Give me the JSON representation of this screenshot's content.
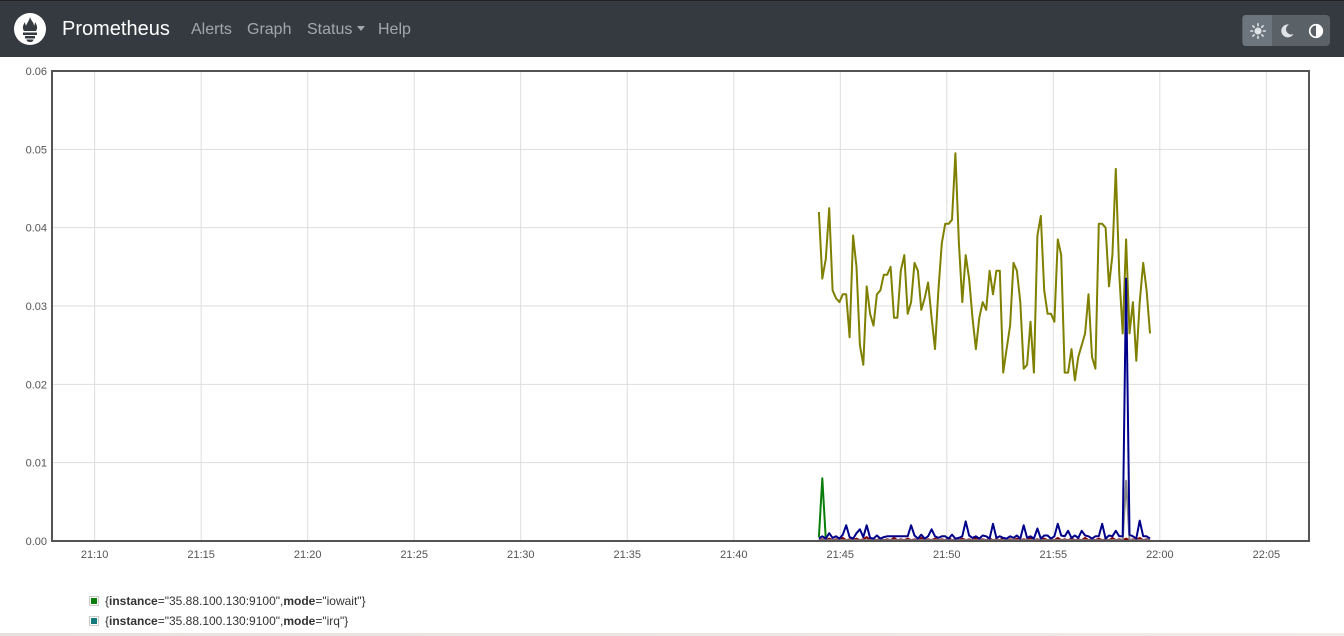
{
  "navbar": {
    "brand": "Prometheus",
    "links": [
      "Alerts",
      "Graph",
      "Status",
      "Help"
    ],
    "theme_buttons": [
      "sun-icon",
      "moon-icon",
      "half-circle-icon"
    ],
    "background": "#343a40"
  },
  "legend": [
    {
      "open": "{",
      "k1": "instance",
      "v1": "=\"35.88.100.130:9100\", ",
      "k2": "mode",
      "v2": "=\"iowait\"}",
      "color": "#0a7d0a"
    },
    {
      "open": "{",
      "k1": "instance",
      "v1": "=\"35.88.100.130:9100\", ",
      "k2": "mode",
      "v2": "=\"irq\"}",
      "color": "#137b7b"
    }
  ],
  "chart_data": {
    "type": "line",
    "x_ticks": [
      "21:10",
      "21:15",
      "21:20",
      "21:25",
      "21:30",
      "21:35",
      "21:40",
      "21:45",
      "21:50",
      "21:55",
      "22:00",
      "22:05"
    ],
    "y_ticks": [
      "0.00",
      "0.01",
      "0.02",
      "0.03",
      "0.04",
      "0.05",
      "0.06"
    ],
    "xlim_minutes": [
      21.1333,
      22.1167
    ],
    "ylim": [
      0,
      0.06
    ],
    "grid": true,
    "series": [
      {
        "color": "#808000",
        "x_start": 21.7333,
        "x_step": 0.00267,
        "values": [
          0.042,
          0.0335,
          0.036,
          0.0425,
          0.032,
          0.031,
          0.0305,
          0.0315,
          0.0315,
          0.026,
          0.039,
          0.035,
          0.025,
          0.0225,
          0.0325,
          0.029,
          0.0275,
          0.0315,
          0.032,
          0.034,
          0.034,
          0.035,
          0.0285,
          0.0285,
          0.0345,
          0.0365,
          0.029,
          0.0305,
          0.0355,
          0.0345,
          0.0295,
          0.031,
          0.033,
          0.0285,
          0.0245,
          0.032,
          0.038,
          0.0405,
          0.0405,
          0.041,
          0.0495,
          0.038,
          0.0305,
          0.0365,
          0.0335,
          0.0285,
          0.0245,
          0.0285,
          0.0305,
          0.0295,
          0.0345,
          0.0315,
          0.0345,
          0.0345,
          0.0215,
          0.0245,
          0.0275,
          0.0355,
          0.0345,
          0.0305,
          0.022,
          0.0225,
          0.028,
          0.0215,
          0.039,
          0.0415,
          0.032,
          0.029,
          0.029,
          0.028,
          0.0385,
          0.0365,
          0.0215,
          0.0215,
          0.0245,
          0.0205,
          0.0235,
          0.025,
          0.0265,
          0.0315,
          0.0235,
          0.022,
          0.0405,
          0.0405,
          0.04,
          0.0325,
          0.0365,
          0.0475,
          0.034,
          0.0265,
          0.0385,
          0.0265,
          0.0305,
          0.023,
          0.0305,
          0.0355,
          0.032,
          0.0265
        ]
      },
      {
        "color": "#0a7d0a",
        "x_start": 21.7333,
        "x_step": 0.00267,
        "values": [
          0.0005,
          0.008,
          0.0002,
          0.0001,
          0.0001,
          0.0001,
          0.0002,
          0.0001,
          0.0001,
          0.0001,
          0.0001,
          0.0001,
          0.0001,
          0.0001,
          0.0001,
          0.0001,
          0.0001,
          0.0001,
          0.0001,
          0.0001,
          0.0001,
          0.0001,
          0.0001,
          0.0001,
          0.0001,
          0.0001,
          0.0001,
          0.0001,
          0.0001,
          0.0001,
          0.0001,
          0.0001,
          0.0001,
          0.0001,
          0.0001,
          0.0001,
          0.0001,
          0.0001,
          0.0001,
          0.0001,
          0.0001,
          0.0001,
          0.0001,
          0.0001,
          0.0001,
          0.0001,
          0.0001,
          0.0001,
          0.0001,
          0.0001,
          0.0001,
          0.0001,
          0.0001,
          0.0001,
          0.0001,
          0.0001,
          0.0001,
          0.0001,
          0.0001,
          0.0001,
          0.0001,
          0.0001,
          0.0001,
          0.0001,
          0.0001,
          0.0001,
          0.0001,
          0.0001,
          0.0001,
          0.0001,
          0.0001,
          0.0001,
          0.0001,
          0.0001,
          0.0001,
          0.0001,
          0.0001,
          0.0001,
          0.0001,
          0.0001,
          0.0001,
          0.0001,
          0.0001,
          0.0001,
          0.0001,
          0.0001,
          0.0001,
          0.0001,
          0.0001,
          0.0001,
          0.0001,
          0.0001,
          0.0001,
          0.0001,
          0.0001,
          0.0001,
          0.0001,
          0.0001
        ]
      },
      {
        "color": "#800000",
        "x_start": 21.7333,
        "x_step": 0.00267,
        "values": [
          0.0001,
          0.0002,
          0.0001,
          0.0003,
          0.0001,
          0.0002,
          0.0001,
          0.0004,
          0.0001,
          0.0002,
          0.0001,
          0.0003,
          0.0001,
          0.0002,
          0.0005,
          0.0001,
          0.0002,
          0.0001,
          0.0003,
          0.0001,
          0.0002,
          0.0001,
          0.0004,
          0.0001,
          0.0002,
          0.0001,
          0.0003,
          0.0001,
          0.0002,
          0.0001,
          0.0004,
          0.0001,
          0.0002,
          0.0001,
          0.0003,
          0.0001,
          0.0002,
          0.0001,
          0.0004,
          0.0001,
          0.0002,
          0.0001,
          0.0003,
          0.0001,
          0.0002,
          0.0001,
          0.0004,
          0.0001,
          0.0002,
          0.0001,
          0.0003,
          0.0001,
          0.0002,
          0.0001,
          0.0004,
          0.0001,
          0.0002,
          0.0001,
          0.0003,
          0.0001,
          0.0002,
          0.0001,
          0.0004,
          0.0001,
          0.0002,
          0.0001,
          0.0003,
          0.0001,
          0.0002,
          0.0001,
          0.0004,
          0.0001,
          0.0002,
          0.0001,
          0.0003,
          0.0001,
          0.0002,
          0.0001,
          0.0004,
          0.0001,
          0.0002,
          0.0001,
          0.0003,
          0.0001,
          0.0002,
          0.0001,
          0.0004,
          0.0001,
          0.0002,
          0.0001,
          0.0003,
          0.0001,
          0.0002,
          0.0001,
          0.0004,
          0.0001,
          0.0002,
          0.0001
        ]
      },
      {
        "color": "#888888",
        "x_start": 21.7333,
        "x_step": 0.00267,
        "values": [
          0.0001,
          0.0001,
          0.0001,
          0.0001,
          0.0001,
          0.0001,
          0.0001,
          0.0001,
          0.0001,
          0.0001,
          0.0001,
          0.0001,
          0.0001,
          0.0001,
          0.0001,
          0.0001,
          0.0001,
          0.0001,
          0.0001,
          0.0001,
          0.0001,
          0.0001,
          0.0001,
          0.0001,
          0.0001,
          0.0001,
          0.0001,
          0.0001,
          0.0001,
          0.0001,
          0.0001,
          0.0001,
          0.0001,
          0.0001,
          0.0001,
          0.0001,
          0.0001,
          0.0001,
          0.0001,
          0.0001,
          0.0001,
          0.0001,
          0.0001,
          0.0001,
          0.0001,
          0.0001,
          0.0001,
          0.0001,
          0.0001,
          0.0001,
          0.0001,
          0.0001,
          0.0001,
          0.0001,
          0.0001,
          0.0001,
          0.0001,
          0.0001,
          0.0001,
          0.0001,
          0.0001,
          0.0001,
          0.0001,
          0.0001,
          0.0001,
          0.0001,
          0.0001,
          0.0001,
          0.0001,
          0.0001,
          0.0001,
          0.0001,
          0.0001,
          0.0001,
          0.0001,
          0.0001,
          0.0001,
          0.0001,
          0.0001,
          0.0001,
          0.0001,
          0.0001,
          0.0001,
          0.0001,
          0.0001,
          0.0001,
          0.0001,
          0.0001,
          0.0001,
          0.0001,
          0.0077,
          0.0002,
          0.0001,
          0.0001,
          0.0001,
          0.0001,
          0.0001,
          0.0001
        ]
      },
      {
        "color": "#00008b",
        "x_start": 21.7333,
        "x_step": 0.00267,
        "values": [
          0.0003,
          0.0006,
          0.0003,
          0.001,
          0.0004,
          0.0006,
          0.0003,
          0.0008,
          0.002,
          0.0005,
          0.0003,
          0.001,
          0.0015,
          0.0005,
          0.002,
          0.0004,
          0.0003,
          0.0007,
          0.0003,
          0.0005,
          0.0006,
          0.0006,
          0.0006,
          0.0006,
          0.0006,
          0.0006,
          0.0006,
          0.002,
          0.0007,
          0.0003,
          0.0008,
          0.0003,
          0.0006,
          0.0015,
          0.0006,
          0.0004,
          0.0006,
          0.0006,
          0.0003,
          0.0008,
          0.0003,
          0.0004,
          0.0006,
          0.0025,
          0.0007,
          0.0004,
          0.0006,
          0.0003,
          0.0007,
          0.0006,
          0.0003,
          0.0022,
          0.0004,
          0.0006,
          0.0004,
          0.0003,
          0.0006,
          0.0004,
          0.0007,
          0.0003,
          0.002,
          0.0004,
          0.0006,
          0.0003,
          0.0016,
          0.0003,
          0.0007,
          0.0007,
          0.0003,
          0.0006,
          0.0022,
          0.0007,
          0.0006,
          0.0013,
          0.0004,
          0.0007,
          0.0004,
          0.0013,
          0.0007,
          0.0006,
          0.0003,
          0.0006,
          0.0006,
          0.0022,
          0.0003,
          0.0007,
          0.0006,
          0.0013,
          0.0006,
          0.0006,
          0.0335,
          0.0008,
          0.0006,
          0.0003,
          0.0026,
          0.0006,
          0.0006,
          0.0003
        ]
      }
    ]
  }
}
